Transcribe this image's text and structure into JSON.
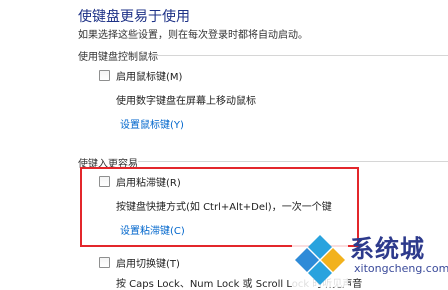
{
  "header": {
    "title": "使键盘更易于使用",
    "subtitle": "如果选择这些设置，则在每次登录时都将自动启动。"
  },
  "section_mouse_keys": {
    "label": "使用键盘控制鼠标",
    "checkbox_label": "启用鼠标键(M)",
    "description": "使用数字键盘在屏幕上移动鼠标",
    "link": "设置鼠标键(Y)"
  },
  "section_easier_typing": {
    "label": "使键入更容易",
    "sticky_checkbox_label": "启用粘滞键(R)",
    "sticky_description": "按键盘快捷方式(如 Ctrl+Alt+Del)，一次一个键",
    "sticky_link": "设置粘滞键(C)",
    "toggle_checkbox_label": "启用切换键(T)",
    "toggle_description": "按 Caps Lock、Num Lock 或 Scroll Lock 时听见声音"
  },
  "watermark": {
    "brand": "系统城",
    "url": "xitongcheng.com"
  },
  "colors": {
    "title": "#1e3287",
    "link": "#0066cc",
    "highlight": "#e3262b"
  }
}
